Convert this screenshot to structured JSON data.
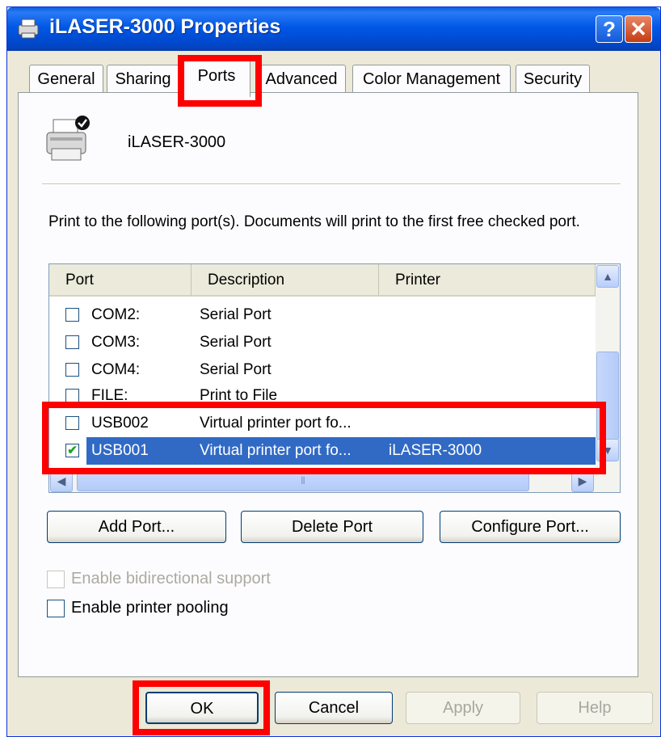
{
  "window": {
    "title": "iLASER-3000 Properties",
    "help_glyph": "?",
    "close_glyph": "✕"
  },
  "tabs": [
    {
      "label": "General"
    },
    {
      "label": "Sharing"
    },
    {
      "label": "Ports",
      "active": true
    },
    {
      "label": "Advanced"
    },
    {
      "label": "Color Management"
    },
    {
      "label": "Security"
    }
  ],
  "printer_name": "iLASER-3000",
  "instructions": "Print to the following port(s). Documents will print to the first free checked port.",
  "port_list": {
    "columns": [
      "Port",
      "Description",
      "Printer"
    ],
    "rows": [
      {
        "port": "COM2:",
        "description": "Serial Port",
        "printer": "",
        "checked": false
      },
      {
        "port": "COM3:",
        "description": "Serial Port",
        "printer": "",
        "checked": false
      },
      {
        "port": "COM4:",
        "description": "Serial Port",
        "printer": "",
        "checked": false
      },
      {
        "port": "FILE:",
        "description": "Print to File",
        "printer": "",
        "checked": false
      },
      {
        "port": "USB002",
        "description": "Virtual printer port fo...",
        "printer": "",
        "checked": false
      },
      {
        "port": "USB001",
        "description": "Virtual printer port fo...",
        "printer": "iLASER-3000",
        "checked": true
      }
    ],
    "scroll_up_glyph": "▲",
    "scroll_down_glyph": "▼",
    "scroll_left_glyph": "◀",
    "scroll_right_glyph": "▶",
    "hthumb_grip": "⦀"
  },
  "port_buttons": {
    "add": "Add Port...",
    "delete": "Delete Port",
    "configure": "Configure Port..."
  },
  "options": {
    "bidirectional": "Enable bidirectional support",
    "pooling": "Enable printer pooling"
  },
  "dialog_buttons": {
    "ok": "OK",
    "cancel": "Cancel",
    "apply": "Apply",
    "help": "Help"
  },
  "colors": {
    "titlebar": "#0058e6",
    "highlight_box": "#ff0000",
    "selection": "#316ac5"
  }
}
